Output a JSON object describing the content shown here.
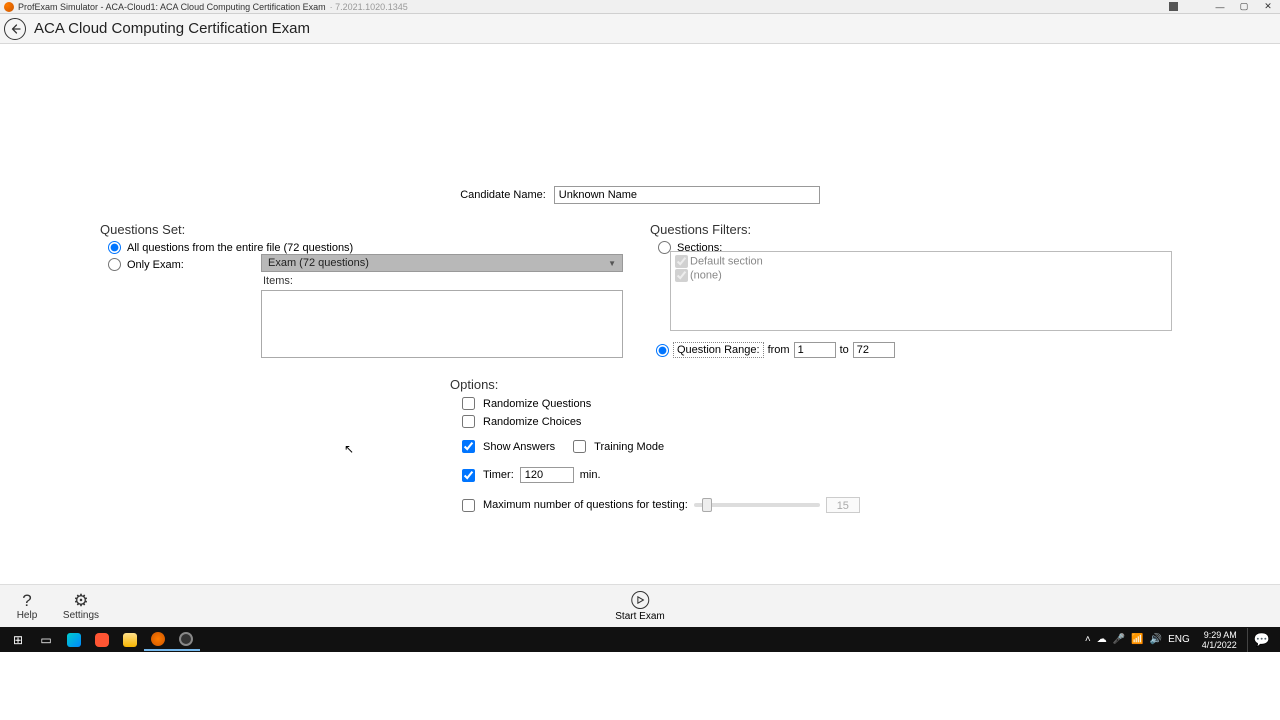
{
  "window": {
    "title_prefix": "ProfExam Simulator - ACA-Cloud1: ACA Cloud Computing Certification Exam",
    "version": "· 7.2021.1020.1345"
  },
  "page": {
    "title": "ACA Cloud Computing Certification Exam"
  },
  "candidate": {
    "label": "Candidate Name:",
    "value": "Unknown Name"
  },
  "questions_set": {
    "title": "Questions Set:",
    "all_label": "All questions from the entire file (72 questions)",
    "only_label": "Only Exam:",
    "selected_exam": "Exam  (72 questions)",
    "items_label": "Items:"
  },
  "filters": {
    "title": "Questions Filters:",
    "sections_label": "Sections:",
    "sections": [
      "Default section",
      "(none)"
    ],
    "range_label": "Question Range:",
    "from_label": "from",
    "to_label": "to",
    "from_value": "1",
    "to_value": "72"
  },
  "options": {
    "title": "Options:",
    "randomize_q": "Randomize Questions",
    "randomize_c": "Randomize Choices",
    "show_answers": "Show Answers",
    "training_mode": "Training Mode",
    "timer_label": "Timer:",
    "timer_value": "120",
    "timer_unit": "min.",
    "max_label": "Maximum number of questions for testing:",
    "max_value": "15"
  },
  "footer": {
    "help": "Help",
    "settings": "Settings",
    "start": "Start Exam"
  },
  "taskbar": {
    "lang": "ENG",
    "time": "9:29 AM",
    "date": "4/1/2022"
  }
}
